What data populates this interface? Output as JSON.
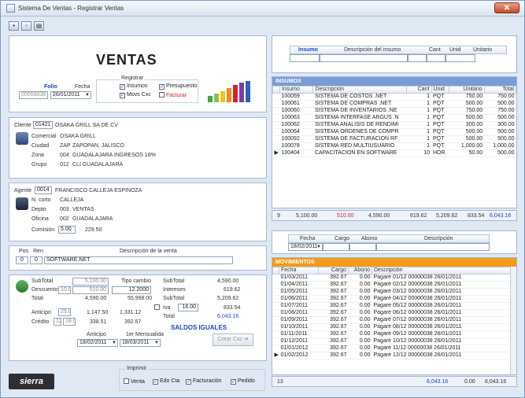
{
  "window": {
    "title": "Sistema De Ventas - Registrar Ventas",
    "close_label": "✕"
  },
  "toolbar": {
    "save_icon": "save-icon",
    "new_icon": "new-icon",
    "print_icon": "print-icon"
  },
  "header": {
    "title": "VENTAS",
    "folio_label": "Folio",
    "folio_value": "00000038",
    "fecha_label": "Fecha",
    "fecha_value": "26/01/2011",
    "registrar_label": "Registrar",
    "insumos_label": "Insumos",
    "movs_label": "Movs Cxc",
    "presupuesto_label": "Presupuesto",
    "facturar_label": "Facturar"
  },
  "cliente": {
    "label": "Cliente",
    "id": "01421",
    "name": "OSAKA GRILL SA DE CV",
    "comercial_label": "Comercial",
    "comercial": "OSAKA GRILL",
    "ciudad_label": "Ciudad",
    "ciudad_code": "ZAP",
    "ciudad": "ZAPOPAN, JALISCO",
    "zona_label": "Zona",
    "zona_code": "004",
    "zona": "GUADALAJARA INGRESOS 16%",
    "grupo_label": "Grupo",
    "grupo_code": "012",
    "grupo": "CLI GUADALAJARA"
  },
  "agente": {
    "label": "Agente",
    "id": "0014",
    "name": "FRANCISCO CALLEJA ESPINOZA",
    "ncorto_label": "N. corto",
    "ncorto": "CALLEJA",
    "depto_label": "Depto",
    "depto_code": "003",
    "depto": "VENTAS",
    "oficina_label": "Oficina",
    "oficina_code": "002",
    "oficina": "GUADALAJARA",
    "comision_label": "Comisión",
    "comision_pct": "5.00",
    "comision_amt": "229.50"
  },
  "partidas": {
    "pos_label": "Pos",
    "ren_label": "Ren",
    "desc_label": "Descripción de la venta",
    "pos": "0",
    "ren": "0",
    "desc": "SOFTWARE.NET"
  },
  "totales": {
    "subtotal_label": "SubTotal",
    "subtotal": "5,100.00",
    "descuento_label": "Descuento",
    "descuento_pct": "10.00",
    "descuento": "510.00",
    "total_label": "Total",
    "total": "4,590.00",
    "tipo_cambio_label": "Tipo cambio",
    "tipo_cambio": "12.2000",
    "tc_desc": "510.00",
    "tc_total": "55,998.00",
    "anticipo_label": "Anticipo",
    "anticipo_pct": "25.00",
    "anticipo": "1,147.50",
    "anticipo2": "1,331.12",
    "credito_label": "Crédito",
    "credito_n": "12",
    "credito_pct": "18.00",
    "credito": "338.51",
    "credito2": "392.67",
    "r_subtotal_label": "SubTotal",
    "r_subtotal": "4,590.00",
    "intereses_label": "Intereses",
    "intereses": "619.62",
    "r_subtotal2_label": "SubTotal",
    "r_subtotal2": "5,209.62",
    "iva_label": "Iva",
    "iva_pct": "16.00",
    "iva": "833.54",
    "r_total_label": "Total",
    "r_total": "6,043.16",
    "saldos": "SALDOS IGUALES",
    "anticipo_fecha_label": "Anticipo",
    "anticipo_fecha": "18/02/2011",
    "mensualidad_label": "1er Mensualida",
    "mensualidad": "18/03/2011",
    "crear_label": "Crear Cxc"
  },
  "imprimir": {
    "label": "Imprimir",
    "venta": "Venta",
    "edo": "Edo Cta",
    "facturacion": "Facturación",
    "pedido": "Pedido"
  },
  "logo": "sierra",
  "insumo_entry": {
    "insumo": "Insumo",
    "desc": "Descripción del insumo",
    "cant": "Cant",
    "unid": "Unid",
    "unitario": "Unitario"
  },
  "insumos": {
    "title": "INSUMOS",
    "cols": [
      "Insumo",
      "Descripción",
      "Cant",
      "Unid",
      "Unitario",
      "Total"
    ],
    "rows": [
      [
        "100059",
        "SISTEMA DE COSTOS .NET",
        "1",
        "PQT",
        "750.00",
        "750.00"
      ],
      [
        "100061",
        "SISTEMA DE COMPRAS .NET",
        "1",
        "PQT",
        "500.00",
        "500.00"
      ],
      [
        "100060",
        "SISTEMA DE INVENTARIOS .NE",
        "1",
        "PQT",
        "750.00",
        "750.00"
      ],
      [
        "100063",
        "SISTEMA INTERFASE ARGUS .N",
        "1",
        "PQT",
        "500.00",
        "500.00"
      ],
      [
        "100062",
        "SISTEMA ANALISIS DE RENDIMI",
        "1",
        "PQT",
        "300.00",
        "300.00"
      ],
      [
        "100064",
        "SISTEMA ORDENES DE COMPR",
        "1",
        "PQT",
        "500.00",
        "500.00"
      ],
      [
        "100092",
        "SISTEMA DE FACTURACION RF",
        "1",
        "PQT",
        "500.00",
        "500.00"
      ],
      [
        "100078",
        "SISTEMA RED MULTIUSUARIO",
        "1",
        "PQT",
        "1,000.00",
        "1,000.00"
      ],
      [
        "100404",
        "CAPACITACION EN SOFTWARE",
        "10",
        "HOR",
        "50.00",
        "500.00"
      ]
    ],
    "footer": {
      "count": "9",
      "subtotal": "5,100.00",
      "desc": "510.00",
      "total": "4,590.00",
      "interes": "619.62",
      "sub2": "5,209.62",
      "iva": "833.54",
      "grand": "6,043.16"
    }
  },
  "mov_entry": {
    "fecha": "Fecha",
    "cargo": "Cargo",
    "abono": "Abono",
    "desc": "Descripción",
    "fecha_value": "18/02/2011"
  },
  "movimientos": {
    "title": "MOVIMIENTOS",
    "cols": [
      "Fecha",
      "Cargo",
      "Abono",
      "Descripción"
    ],
    "rows": [
      [
        "01/03/2011",
        "392.67",
        "0.00",
        "Pagaré 01/12 00000038 26/01/2011"
      ],
      [
        "01/04/2011",
        "392.67",
        "0.00",
        "Pagaré 02/12 00000038 26/01/2011"
      ],
      [
        "01/05/2011",
        "392.67",
        "0.00",
        "Pagaré 03/12 00000038 26/01/2011"
      ],
      [
        "01/06/2011",
        "392.67",
        "0.00",
        "Pagaré 04/12 00000038 26/01/2011"
      ],
      [
        "01/07/2011",
        "392.67",
        "0.00",
        "Pagaré 05/12 00000038 26/01/2011"
      ],
      [
        "01/08/2011",
        "392.67",
        "0.00",
        "Pagaré 06/12 00000038 26/01/2011"
      ],
      [
        "01/09/2011",
        "392.67",
        "0.00",
        "Pagaré 07/12 00000038 26/01/2011"
      ],
      [
        "01/10/2011",
        "392.67",
        "0.00",
        "Pagaré 08/12 00000038 26/01/2011"
      ],
      [
        "01/11/2011",
        "392.67",
        "0.00",
        "Pagaré 09/12 00000038 26/01/2011"
      ],
      [
        "01/12/2011",
        "392.67",
        "0.00",
        "Pagaré 10/12 00000038 26/01/2011"
      ],
      [
        "01/01/2012",
        "392.67",
        "0.00",
        "Pagaré 11/12 00000038 26/01/2011"
      ],
      [
        "01/02/2012",
        "392.67",
        "0.00",
        "Pagaré 12/12 00000038 26/01/2011"
      ]
    ],
    "footer": {
      "count": "13",
      "cargo": "6,043.16",
      "abono": "0.00",
      "saldo": "6,043.16"
    }
  },
  "colors": {
    "insumos_band": "#7a9bd6",
    "movs_band": "#f29b1a",
    "accent_blue": "#1a46c4",
    "accent_red": "#d8202a"
  }
}
